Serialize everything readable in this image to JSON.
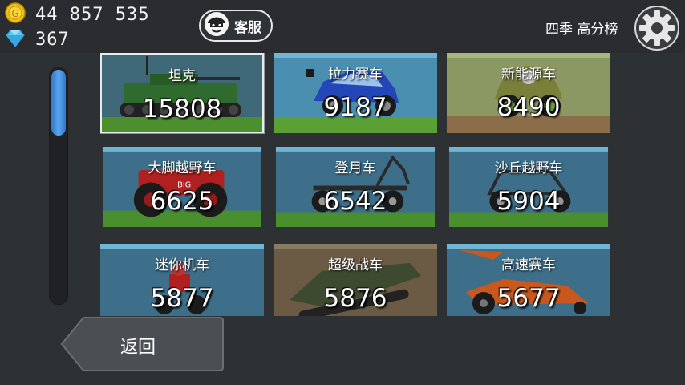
{
  "hud": {
    "coins": "44 857 535",
    "gems": "367",
    "coin_icon": "coin-icon",
    "gem_icon": "diamond-icon"
  },
  "support": {
    "label": "客服",
    "icon": "mascot-face-icon"
  },
  "leaderboard": {
    "label": "四季 高分榜"
  },
  "settings": {
    "icon": "gear-icon"
  },
  "scroll": {
    "position": 0
  },
  "vehicles": [
    {
      "name": "坦克",
      "score": "15808",
      "selected": true
    },
    {
      "name": "拉力赛车",
      "score": "9187"
    },
    {
      "name": "新能源车",
      "score": "8490"
    },
    {
      "name": "大脚越野车",
      "score": "6625"
    },
    {
      "name": "登月车",
      "score": "6542"
    },
    {
      "name": "沙丘越野车",
      "score": "5904"
    },
    {
      "name": "迷你机车",
      "score": "5877"
    },
    {
      "name": "超级战车",
      "score": "5876"
    },
    {
      "name": "高速赛车",
      "score": "5677"
    }
  ],
  "back": {
    "label": "返回"
  },
  "colors": {
    "accent_blue": "#4a9be8",
    "coin_gold": "#f2c010",
    "gem_blue": "#5ec8f0",
    "tile_sky": "#3d6f8a",
    "grass": "#6ab83a"
  }
}
